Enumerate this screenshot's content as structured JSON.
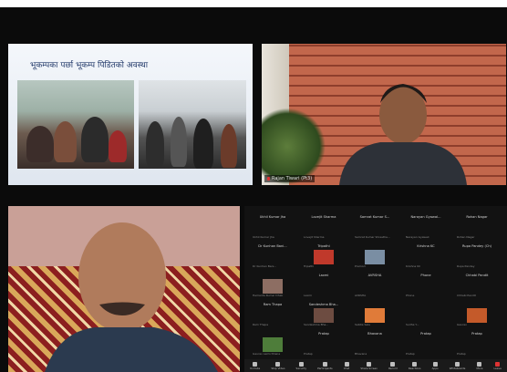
{
  "slide": {
    "title": "भूकम्पका पर्छा  भूकम्प पिडितको अवस्था"
  },
  "speaker_right": {
    "name": "Rajan Tiwari (Pt3)"
  },
  "gallery": {
    "participants": [
      {
        "name": "Ukhil Kumar Jha",
        "sub": "Ukhil Kumar Jha"
      },
      {
        "name": "Lovejit Sharma",
        "sub": "Lovejit Sharma"
      },
      {
        "name": "Samrat Kumar S...",
        "sub": "Samrat Kumar Shrestha..."
      },
      {
        "name": "Narayan Gyawal...",
        "sub": "Narayan Gyawali"
      },
      {
        "name": "Rohan Nagar",
        "sub": "Rohan Nagar"
      },
      {
        "name": "Dr Kunhan Bani...",
        "sub": "Dr Kunhan Bani..."
      },
      {
        "name": "Tripathi",
        "sub": "Tripathi"
      },
      {
        "name": "",
        "sub": "Pramod"
      },
      {
        "name": "Krishna KC",
        "sub": "Krishna KC"
      },
      {
        "name": "Rupa Pandey (Ch)",
        "sub": "Rupa Pandey"
      },
      {
        "name": "",
        "sub": "Hemanta Kumar Dhak"
      },
      {
        "name": "Laxmi",
        "sub": "Laxmi"
      },
      {
        "name": "AVRSHA",
        "sub": "AVRSHA"
      },
      {
        "name": "Phone",
        "sub": "Phone"
      },
      {
        "name": "Chhabi Pandit",
        "sub": "Chhabi Pandit"
      },
      {
        "name": "Ram Thapa",
        "sub": "Ram Thapa"
      },
      {
        "name": "Sandeshma Bha...",
        "sub": "Sandeshma Bha..."
      },
      {
        "name": "",
        "sub": "Sabita Sala"
      },
      {
        "name": "",
        "sub": "Sudha Y..."
      },
      {
        "name": "",
        "sub": "Gaurav"
      },
      {
        "name": "",
        "sub": "Gaurav Lamichhane"
      },
      {
        "name": "Pratap",
        "sub": "Pratap"
      },
      {
        "name": "Bhavana",
        "sub": "Bhavana"
      },
      {
        "name": "Pratap",
        "sub": "Pratap"
      },
      {
        "name": "Pratap",
        "sub": "Pratap"
      }
    ]
  },
  "toolbar": {
    "items": [
      "Unmute",
      "Stop Video",
      "Security",
      "Participants",
      "Chat",
      "Share Screen",
      "Record",
      "Reactions",
      "Apps",
      "Whiteboards",
      "More",
      "Leave"
    ]
  }
}
